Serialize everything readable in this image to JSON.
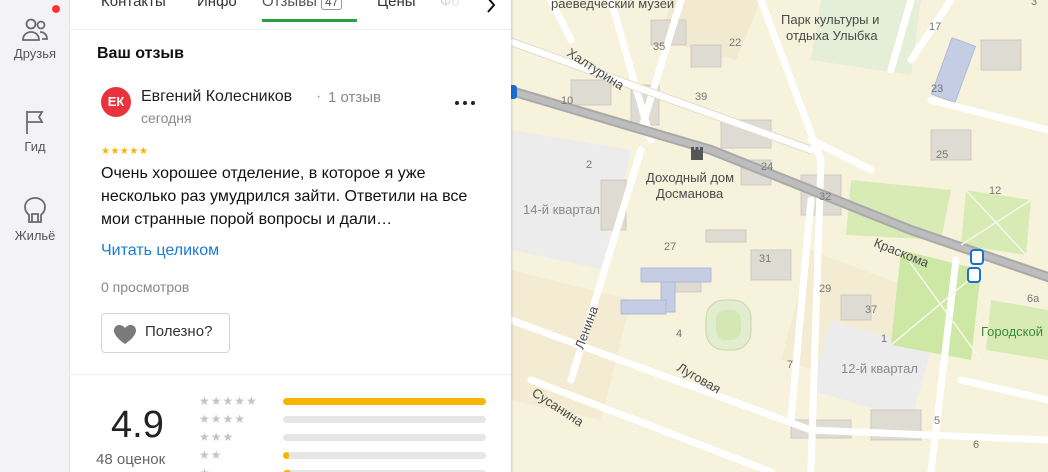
{
  "sidebar": {
    "items": [
      {
        "label": "Друзья",
        "icon": "people-icon"
      },
      {
        "label": "Гид",
        "icon": "flag-icon"
      },
      {
        "label": "Жильё",
        "icon": "house-icon"
      }
    ],
    "notification_color": "#ff3333"
  },
  "tabs": {
    "items": [
      {
        "label": "Контакты"
      },
      {
        "label": "Инфо"
      },
      {
        "label": "Отзывы",
        "badge": "47",
        "active": true
      },
      {
        "label": "Цены"
      },
      {
        "label": "Фо"
      }
    ],
    "next_icon": "chevron-right-icon",
    "active_color": "#2aa13f"
  },
  "review": {
    "section_title": "Ваш отзыв",
    "avatar_initials": "ЕК",
    "avatar_color": "#e8323c",
    "author": "Евгений Колесников",
    "separator": "·",
    "author_reviews": "1 отзыв",
    "date": "сегодня",
    "rating": 5,
    "stars_text": "★★★★★",
    "text": "Очень хорошее отделение, в которое я уже несколько раз умудрился зайти. Ответили на все мои странные порой вопросы и дали…",
    "read_more": "Читать целиком",
    "views": "0 просмотров",
    "helpful": "Полезно?",
    "more_icon": "more-dots-icon"
  },
  "rating_summary": {
    "value": "4.9",
    "count": "48 оценок",
    "star_color": "#f6b600",
    "distribution": [
      {
        "stars": "★★★★★",
        "share": 1.0
      },
      {
        "stars": "★★★★",
        "share": 0.0
      },
      {
        "stars": "★★★",
        "share": 0.0
      },
      {
        "stars": "★★",
        "share": 0.03
      },
      {
        "stars": "★",
        "share": 0.04
      }
    ]
  },
  "map": {
    "labels": {
      "museum": "раеведческий музей",
      "park": "Парк культуры и\nотдыха Улыбка",
      "khalturina": "Халтурина",
      "dom": "Доходный дом\nДосманова",
      "kvartal14": "14-й квартал",
      "kraskoma": "Краскома",
      "lenina": "Ленина",
      "lugovaya": "Луговая",
      "susanina": "Сусанина",
      "kvartal12": "12-й квартал",
      "gorodskoy": "Городской"
    },
    "house_numbers": [
      "35",
      "22",
      "17",
      "3",
      "10",
      "39",
      "23",
      "2",
      "24",
      "25",
      "32",
      "12",
      "27",
      "4",
      "31",
      "29",
      "37",
      "6а",
      "1",
      "5",
      "7",
      "6"
    ]
  }
}
